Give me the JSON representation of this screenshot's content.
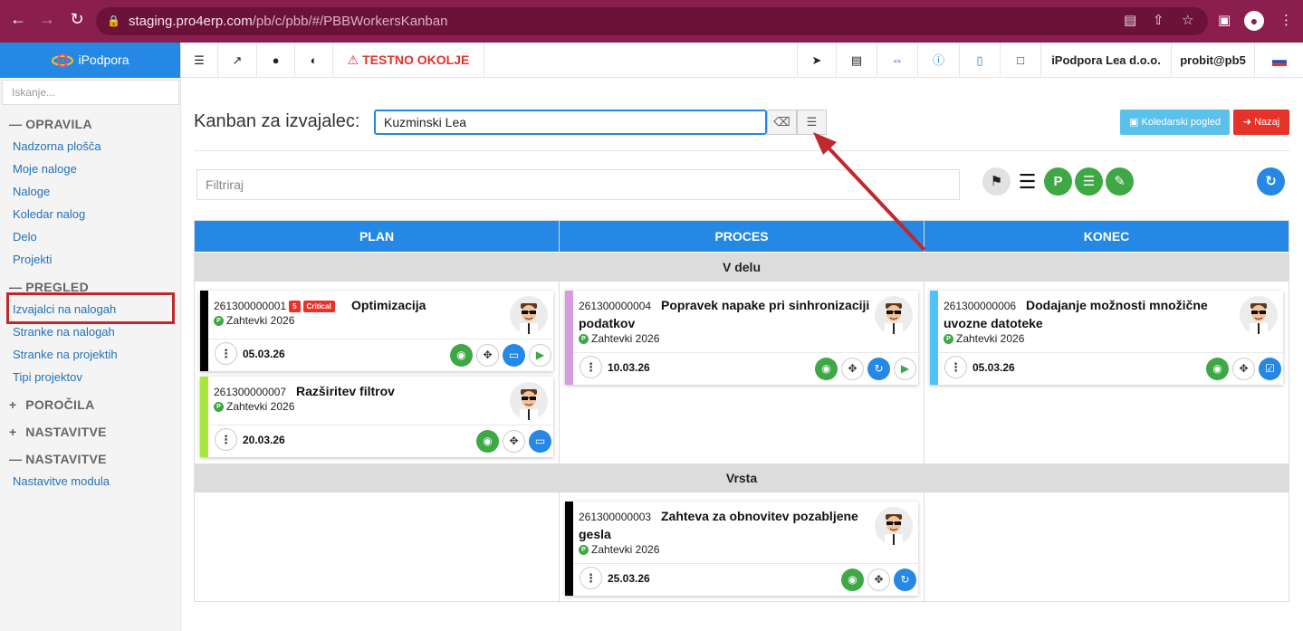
{
  "browser": {
    "url_host": "staging.pro4erp.com",
    "url_path": "/pb/c/pbb/#/PBBWorkersKanban"
  },
  "sidebar": {
    "brand": "iPodpora",
    "search_placeholder": "Iskanje...",
    "sections": [
      {
        "symbol": "—",
        "label": "OPRAVILA"
      },
      {
        "symbol": "—",
        "label": "PREGLED"
      },
      {
        "symbol": "+",
        "label": "POROČILA"
      },
      {
        "symbol": "+",
        "label": "NASTAVITVE"
      },
      {
        "symbol": "—",
        "label": "NASTAVITVE"
      }
    ],
    "opravila_items": [
      "Nadzorna plošča",
      "Moje naloge",
      "Naloge",
      "Koledar nalog",
      "Delo",
      "Projekti"
    ],
    "pregled_items": [
      "Izvajalci na nalogah",
      "Stranke na nalogah",
      "Stranke na projektih",
      "Tipi projektov"
    ],
    "nastavitve_items": [
      "Nastavitve modula"
    ],
    "active_item": "Izvajalci na nalogah"
  },
  "topbar": {
    "warning": "TESTNO OKOLJE",
    "company": "iPodpora Lea d.o.o.",
    "user": "probit@pb5"
  },
  "page": {
    "title": "Kanban za izvajalec:",
    "worker_value": "Kuzminski Lea",
    "calendar_button": "Koledarski pogled",
    "back_button": "Nazaj",
    "filter_placeholder": "Filtriraj"
  },
  "board": {
    "columns": [
      "PLAN",
      "PROCES",
      "KONEC"
    ],
    "lanes": [
      "V delu",
      "Vrsta"
    ],
    "cards": [
      {
        "id": "261300000001",
        "count": "5",
        "priority": "Critical",
        "title": "Optimizacija",
        "project": "Zahtevki 2026",
        "date": "05.03.26",
        "color": "#000000"
      },
      {
        "id": "261300000007",
        "title": "Razširitev filtrov",
        "project": "Zahtevki 2026",
        "date": "20.03.26",
        "color": "#a8e83a"
      },
      {
        "id": "261300000004",
        "title": "Popravek napake pri sinhronizaciji",
        "title2": "podatkov",
        "project": "Zahtevki 2026",
        "date": "10.03.26",
        "color": "#d99be0"
      },
      {
        "id": "261300000006",
        "title": "Dodajanje možnosti množične",
        "title2": "uvozne datoteke",
        "project": "Zahtevki 2026",
        "date": "05.03.26",
        "color": "#4fc3f7"
      },
      {
        "id": "261300000003",
        "title": "Zahteva za obnovitev pozabljene",
        "title2": "gesla",
        "project": "Zahtevki 2026",
        "date": "25.03.26",
        "color": "#000000"
      }
    ]
  },
  "colors": {
    "browser_bar": "#8a1e4e",
    "primary": "#2488e4",
    "danger": "#e5332a",
    "success": "#3ea844",
    "annotation": "#c0282d"
  }
}
